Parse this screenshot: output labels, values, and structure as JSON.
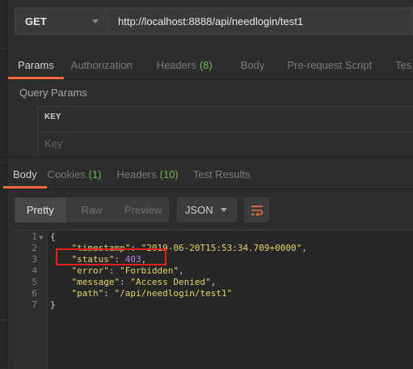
{
  "request": {
    "method": "GET",
    "url": "http://localhost:8888/api/needlogin/test1"
  },
  "request_tabs": [
    {
      "label": "Params",
      "count": ""
    },
    {
      "label": "Authorization",
      "count": ""
    },
    {
      "label": "Headers",
      "count": "(8)"
    },
    {
      "label": "Body",
      "count": ""
    },
    {
      "label": "Pre-request Script",
      "count": ""
    },
    {
      "label": "Tes",
      "count": ""
    }
  ],
  "query_params": {
    "title": "Query Params",
    "key_header": "KEY",
    "key_placeholder": "Key"
  },
  "response_tabs": [
    {
      "label": "Body",
      "count": ""
    },
    {
      "label": "Cookies",
      "count": "(1)"
    },
    {
      "label": "Headers",
      "count": "(10)"
    },
    {
      "label": "Test Results",
      "count": ""
    }
  ],
  "view_modes": [
    "Pretty",
    "Raw",
    "Preview"
  ],
  "format": "JSON",
  "code": {
    "line_numbers": [
      "1",
      "2",
      "3",
      "4",
      "5",
      "6",
      "7"
    ],
    "lines": [
      [
        {
          "t": "{",
          "c": "p"
        }
      ],
      [
        {
          "t": "    ",
          "c": "p"
        },
        {
          "t": "\"timestamp\"",
          "c": "k"
        },
        {
          "t": ": ",
          "c": "p"
        },
        {
          "t": "\"2019-06-20T15:53:34.709+0000\"",
          "c": "s"
        },
        {
          "t": ",",
          "c": "p"
        }
      ],
      [
        {
          "t": "    ",
          "c": "p"
        },
        {
          "t": "\"status\"",
          "c": "k"
        },
        {
          "t": ": ",
          "c": "p"
        },
        {
          "t": "403",
          "c": "n"
        },
        {
          "t": ",",
          "c": "p"
        }
      ],
      [
        {
          "t": "    ",
          "c": "p"
        },
        {
          "t": "\"error\"",
          "c": "k"
        },
        {
          "t": ": ",
          "c": "p"
        },
        {
          "t": "\"Forbidden\"",
          "c": "s"
        },
        {
          "t": ",",
          "c": "p"
        }
      ],
      [
        {
          "t": "    ",
          "c": "p"
        },
        {
          "t": "\"message\"",
          "c": "k"
        },
        {
          "t": ": ",
          "c": "p"
        },
        {
          "t": "\"Access Denied\"",
          "c": "s"
        },
        {
          "t": ",",
          "c": "p"
        }
      ],
      [
        {
          "t": "    ",
          "c": "p"
        },
        {
          "t": "\"path\"",
          "c": "k"
        },
        {
          "t": ": ",
          "c": "p"
        },
        {
          "t": "\"/api/needlogin/test1\"",
          "c": "s"
        }
      ],
      [
        {
          "t": "}",
          "c": "p"
        }
      ]
    ]
  },
  "colors": {
    "accent": "#f26b3a",
    "count": "#6cbc4d",
    "json_key": "#e3d267",
    "json_number": "#b37fe0",
    "annotation": "#e8201c"
  }
}
